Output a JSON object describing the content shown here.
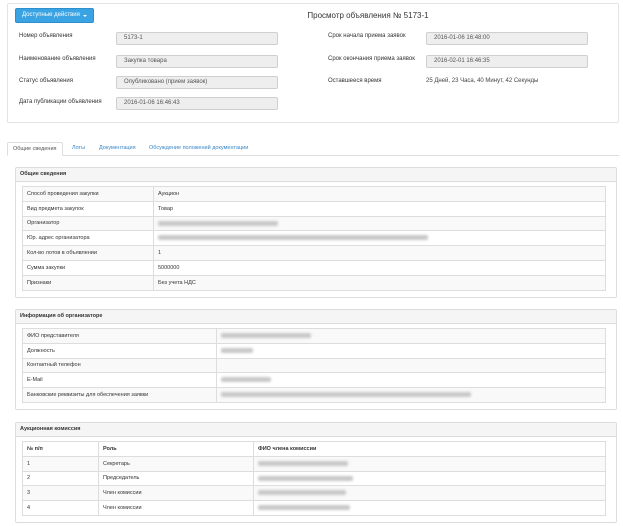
{
  "header": {
    "actions_label": "Доступные действия",
    "title": "Просмотр объявления № 5173-1"
  },
  "fields_left": [
    {
      "label": "Номер объявления",
      "value": "5173-1"
    },
    {
      "label": "Наименование объявления",
      "value": "Закупка товара"
    },
    {
      "label": "Статус объявления",
      "value": "Опубликовано (прием заявок)"
    },
    {
      "label": "Дата публикации объявления",
      "value": "2016-01-06 16:46:43"
    }
  ],
  "fields_right": [
    {
      "label": "Срок начала приема заявок",
      "value": "2016-01-06 16:48:00"
    },
    {
      "label": "Срок окончания приема заявок",
      "value": "2016-02-01 16:46:35"
    },
    {
      "label": "Оставшееся время",
      "value": "25 Дней, 23 Часа, 40 Минут, 42 Секунды"
    }
  ],
  "tabs": [
    "Общие сведения",
    "Лоты",
    "Документация",
    "Обсуждение положений документации"
  ],
  "general": {
    "title": "Общие сведения",
    "rows": [
      {
        "label": "Способ проведения закупки",
        "value": "Аукцион",
        "blurred": false
      },
      {
        "label": "Вид предмета закупок",
        "value": "Товар",
        "blurred": false
      },
      {
        "label": "Организатор",
        "value": "",
        "blurred": true
      },
      {
        "label": "Юр. адрес организатора",
        "value": "",
        "blurred": true
      },
      {
        "label": "Кол-во лотов в объявлении",
        "value": "1",
        "blurred": false
      },
      {
        "label": "Сумма закупки",
        "value": "5000000",
        "blurred": false
      },
      {
        "label": "Признаки",
        "value": "Без учета НДС",
        "blurred": false
      }
    ]
  },
  "organizer": {
    "title": "Информация об организаторе",
    "rows": [
      {
        "label": "ФИО представителя",
        "blurred": true
      },
      {
        "label": "Должность",
        "blurred": true
      },
      {
        "label": "Контактный телефон",
        "blurred": false
      },
      {
        "label": "E-Mail",
        "blurred": true
      },
      {
        "label": "Банковские реквизиты для обеспечения заявки",
        "blurred": true
      }
    ]
  },
  "commission": {
    "title": "Аукционная комиссия",
    "headers": [
      "№ п/п",
      "Роль",
      "ФИО члена комиссии"
    ],
    "rows": [
      {
        "num": "1",
        "role": "Секретарь"
      },
      {
        "num": "2",
        "role": "Председатель"
      },
      {
        "num": "3",
        "role": "Член комиссии"
      },
      {
        "num": "4",
        "role": "Член комиссии"
      }
    ]
  },
  "colors": {
    "accent": "#3aa3e3",
    "link": "#3a87c7"
  }
}
